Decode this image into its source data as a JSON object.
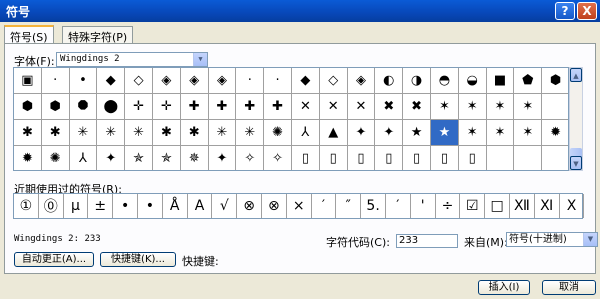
{
  "window": {
    "title": "符号",
    "help_label": "?",
    "close_label": "X"
  },
  "tabs": [
    {
      "label": "符号(S)",
      "active": true
    },
    {
      "label": "特殊字符(P)",
      "active": false
    }
  ],
  "font": {
    "label": "字体(F):",
    "value": "Wingdings 2"
  },
  "symbol_rows": [
    [
      "▣",
      "·",
      "•",
      "◆",
      "◇",
      "◈",
      "◈",
      "◈",
      "·",
      "·",
      "◆",
      "◇",
      "◈",
      "◐",
      "◑",
      "◓",
      "◒",
      "■",
      "⬟",
      "⬢"
    ],
    [
      "⬢",
      "⬢",
      "⯃",
      "⬤",
      "✛",
      "✛",
      "✚",
      "✚",
      "✚",
      "✚",
      "✕",
      "✕",
      "✕",
      "✖",
      "✖",
      "✶",
      "✶",
      "✶",
      "✶"
    ],
    [
      "✱",
      "✱",
      "✳",
      "✳",
      "✳",
      "✱",
      "✱",
      "✳",
      "✳",
      "✺",
      "⅄",
      "▲",
      "✦",
      "✦",
      "★",
      "★",
      "✶",
      "✶",
      "✶",
      "✹"
    ],
    [
      "✹",
      "✺",
      "⅄",
      "✦",
      "✯",
      "✯",
      "✵",
      "✦",
      "✧",
      "✧",
      "▯",
      "▯",
      "▯",
      "▯",
      "▯",
      "▯",
      "▯",
      "",
      "",
      "",
      ""
    ]
  ],
  "selected_symbol": {
    "row": 2,
    "col": 15
  },
  "recent": {
    "label": "近期使用过的符号(R):",
    "symbols": [
      "①",
      "⓪",
      "μ",
      "±",
      "•",
      "•",
      "Å",
      "A",
      "√",
      "⊗",
      "⊗",
      "×",
      "′",
      "″",
      "5.",
      "′",
      "'",
      "÷",
      "☑",
      "□",
      "Ⅻ",
      "Ⅺ",
      "Ⅹ"
    ]
  },
  "status": {
    "font_code": "Wingdings 2: 233"
  },
  "char_code": {
    "label": "字符代码(C):",
    "value": "233"
  },
  "from": {
    "label": "来自(M):",
    "value": "符号(十进制)"
  },
  "buttons": {
    "autocorrect": "自动更正(A)...",
    "shortcut_key": "快捷键(K)...",
    "shortcut_label": "快捷键:",
    "insert": "插入(I)",
    "cancel": "取消"
  }
}
